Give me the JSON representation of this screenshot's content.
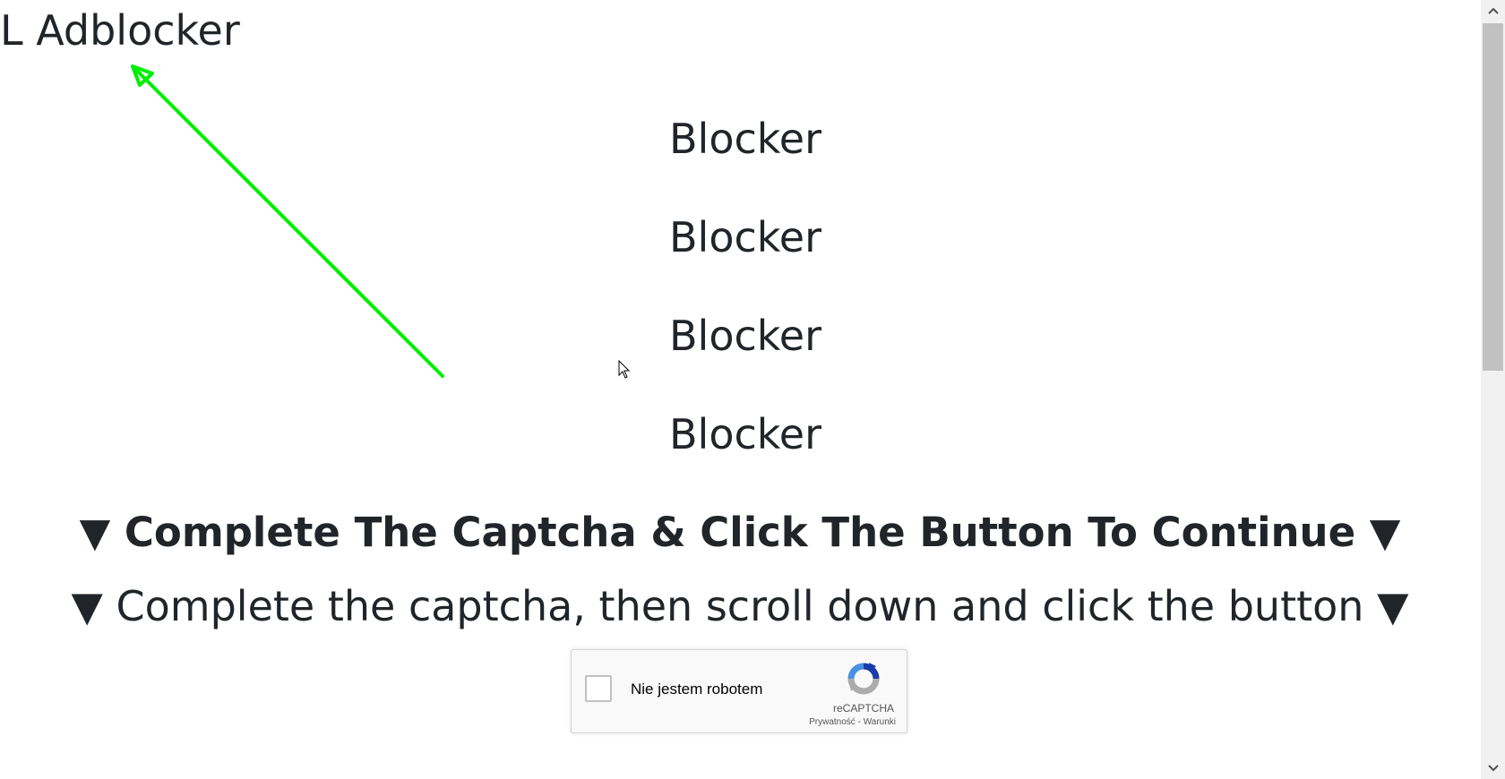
{
  "header": {
    "text": "L Adblocker"
  },
  "blockers": [
    "Blocker",
    "Blocker",
    "Blocker",
    "Blocker"
  ],
  "instructions": {
    "primary": "▼ Complete The Captcha & Click The Button To Continue ▼",
    "secondary": "▼ Complete the captcha, then scroll down and click the button ▼"
  },
  "recaptcha": {
    "label": "Nie jestem robotem",
    "brand": "reCAPTCHA",
    "privacy_link": "Prywatność",
    "separator": " - ",
    "terms_link": "Warunki",
    "icon": "recaptcha-logo-icon"
  },
  "annotation": {
    "arrow_color": "#00ee00",
    "icon": "arrow-pointer-icon"
  },
  "scrollbar": {
    "up_icon": "chevron-up-icon",
    "down_icon": "chevron-down-icon"
  },
  "colors": {
    "text": "#212529",
    "background": "#ffffff",
    "arrow": "#00ee00"
  }
}
